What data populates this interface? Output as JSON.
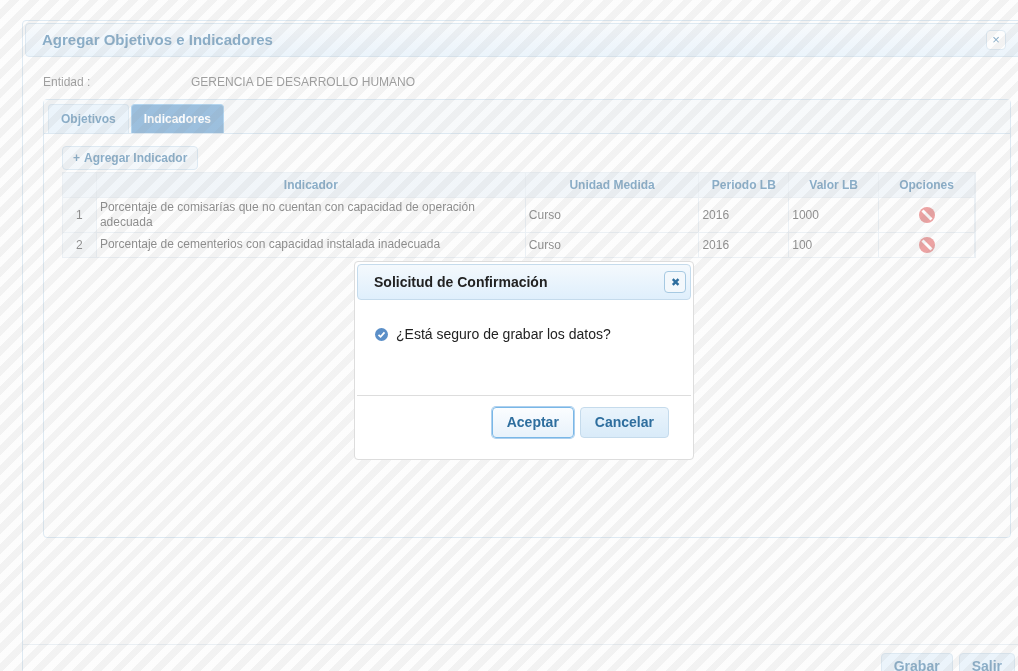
{
  "window": {
    "title": "Agregar Objetivos e Indicadores",
    "close": "×"
  },
  "entity": {
    "label": "Entidad :",
    "value": "GERENCIA DE DESARROLLO HUMANO"
  },
  "tabs": [
    {
      "label": "Objetivos",
      "selected": false
    },
    {
      "label": "Indicadores",
      "selected": true
    }
  ],
  "add_button": {
    "icon": "+",
    "label": "Agregar Indicador"
  },
  "table": {
    "columns": [
      "Indicador",
      "Unidad Medida",
      "Periodo LB",
      "Valor LB",
      "Opciones"
    ],
    "rows": [
      {
        "number": "1",
        "indicador": "Porcentaje de comisarías que no cuentan con capacidad de operación adecuada",
        "unidad": "Curso",
        "periodo": "2016",
        "valor": "1000"
      },
      {
        "number": "2",
        "indicador": "Porcentaje de cementerios con capacidad instalada inadecuada",
        "unidad": "Curso",
        "periodo": "2016",
        "valor": "100"
      }
    ]
  },
  "footer_buttons": [
    "Grabar",
    "Salir"
  ],
  "confirm": {
    "title": "Solicitud de Confirmación",
    "close": "✖",
    "message": "¿Está seguro de grabar los datos?",
    "buttons": [
      {
        "label": "Aceptar",
        "focused": true
      },
      {
        "label": "Cancelar",
        "focused": false
      }
    ]
  }
}
